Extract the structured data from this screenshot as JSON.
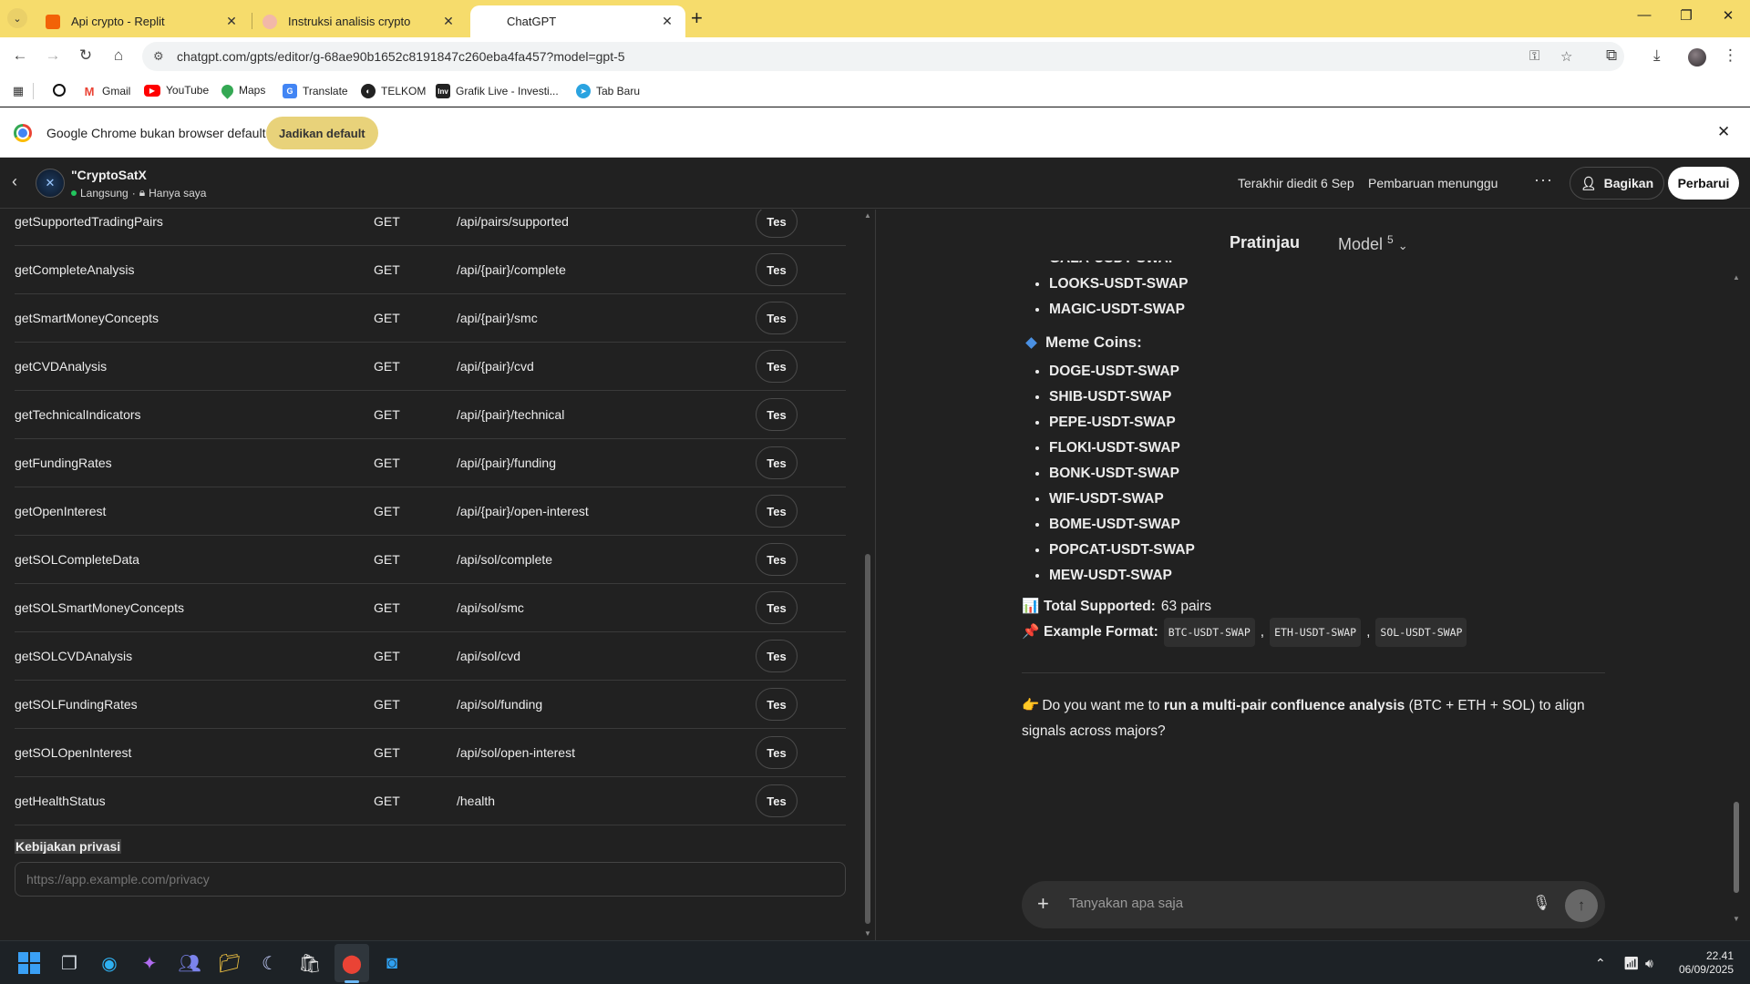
{
  "browser": {
    "tabs": [
      {
        "title": "Api crypto - Replit",
        "favicon_color": "#f26207"
      },
      {
        "title": "Instruksi analisis crypto",
        "favicon_color": "#f2b8a8"
      },
      {
        "title": "ChatGPT",
        "favicon_color": "#ffffff"
      }
    ],
    "url": "chatgpt.com/gpts/editor/g-68ae90b1652c8191847c260eba4fa457?model=gpt-5",
    "bookmarks": [
      {
        "label": "Gmail",
        "icon": "gmail-icon",
        "color": "#ea4335"
      },
      {
        "label": "YouTube",
        "icon": "youtube-icon",
        "color": "#ff0000"
      },
      {
        "label": "Maps",
        "icon": "maps-icon",
        "color": "#34a853"
      },
      {
        "label": "Translate",
        "icon": "translate-icon",
        "color": "#4285f4"
      },
      {
        "label": "TELKOM",
        "icon": "telkom-icon",
        "color": "#222222"
      },
      {
        "label": "Grafik Live - Investi...",
        "icon": "investing-icon",
        "color": "#222222"
      },
      {
        "label": "Tab Baru",
        "icon": "telegram-icon",
        "color": "#2aa3e0"
      }
    ],
    "infobar": {
      "message": "Google Chrome bukan browser default",
      "button": "Jadikan default"
    }
  },
  "editor_header": {
    "gpt_name": "\"CryptoSatX",
    "status": "Langsung",
    "visibility": "Hanya saya",
    "last_edited": "Terakhir diedit 6 Sep",
    "pending": "Pembaruan menunggu",
    "share": "Bagikan",
    "update": "Perbarui"
  },
  "actions": {
    "rows": [
      {
        "op": "getSupportedTradingPairs",
        "method": "GET",
        "path": "/api/pairs/supported",
        "btn": "Tes"
      },
      {
        "op": "getCompleteAnalysis",
        "method": "GET",
        "path": "/api/{pair}/complete",
        "btn": "Tes"
      },
      {
        "op": "getSmartMoneyConcepts",
        "method": "GET",
        "path": "/api/{pair}/smc",
        "btn": "Tes"
      },
      {
        "op": "getCVDAnalysis",
        "method": "GET",
        "path": "/api/{pair}/cvd",
        "btn": "Tes"
      },
      {
        "op": "getTechnicalIndicators",
        "method": "GET",
        "path": "/api/{pair}/technical",
        "btn": "Tes"
      },
      {
        "op": "getFundingRates",
        "method": "GET",
        "path": "/api/{pair}/funding",
        "btn": "Tes"
      },
      {
        "op": "getOpenInterest",
        "method": "GET",
        "path": "/api/{pair}/open-interest",
        "btn": "Tes"
      },
      {
        "op": "getSOLCompleteData",
        "method": "GET",
        "path": "/api/sol/complete",
        "btn": "Tes"
      },
      {
        "op": "getSOLSmartMoneyConcepts",
        "method": "GET",
        "path": "/api/sol/smc",
        "btn": "Tes"
      },
      {
        "op": "getSOLCVDAnalysis",
        "method": "GET",
        "path": "/api/sol/cvd",
        "btn": "Tes"
      },
      {
        "op": "getSOLFundingRates",
        "method": "GET",
        "path": "/api/sol/funding",
        "btn": "Tes"
      },
      {
        "op": "getSOLOpenInterest",
        "method": "GET",
        "path": "/api/sol/open-interest",
        "btn": "Tes"
      },
      {
        "op": "getHealthStatus",
        "method": "GET",
        "path": "/health",
        "btn": "Tes"
      }
    ],
    "privacy_label": "Kebijakan privasi",
    "privacy_placeholder": "https://app.example.com/privacy"
  },
  "preview": {
    "tab_preview": "Pratinjau",
    "tab_model": "Model",
    "model_version": "5",
    "cut_item": "GALA-USDT-SWAP",
    "top_items": [
      "LOOKS-USDT-SWAP",
      "MAGIC-USDT-SWAP"
    ],
    "meme_heading": "Meme Coins:",
    "meme_items": [
      "DOGE-USDT-SWAP",
      "SHIB-USDT-SWAP",
      "PEPE-USDT-SWAP",
      "FLOKI-USDT-SWAP",
      "BONK-USDT-SWAP",
      "WIF-USDT-SWAP",
      "BOME-USDT-SWAP",
      "POPCAT-USDT-SWAP",
      "MEW-USDT-SWAP"
    ],
    "total_label": "Total Supported:",
    "total_value": "63 pairs",
    "format_label": "Example Format:",
    "format_codes": [
      "BTC-USDT-SWAP",
      "ETH-USDT-SWAP",
      "SOL-USDT-SWAP"
    ],
    "followup_pre": "Do you want me to ",
    "followup_bold": "run a multi-pair confluence analysis",
    "followup_post": " (BTC + ETH + SOL) to align signals across majors?",
    "composer_placeholder": "Tanyakan apa saja"
  },
  "taskbar": {
    "time": "22.41",
    "date": "06/09/2025"
  }
}
